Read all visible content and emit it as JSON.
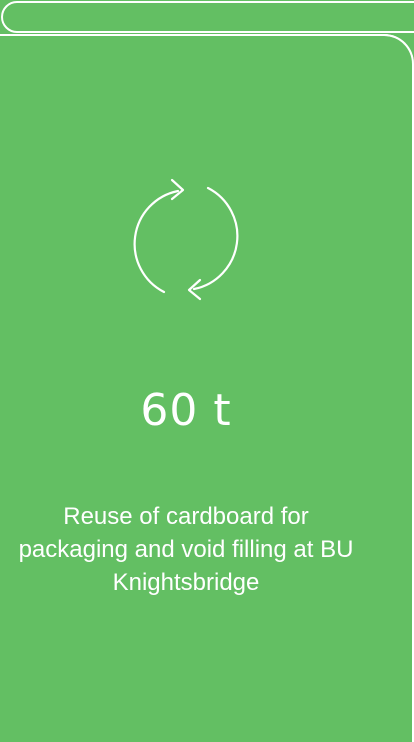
{
  "card": {
    "icon": "recycle-arrows-icon",
    "value": "60 t",
    "description": "Reuse of cardboard for packaging and void filling at BU Knightsbridge"
  },
  "colors": {
    "background": "#63bf63",
    "foreground": "#ffffff"
  }
}
